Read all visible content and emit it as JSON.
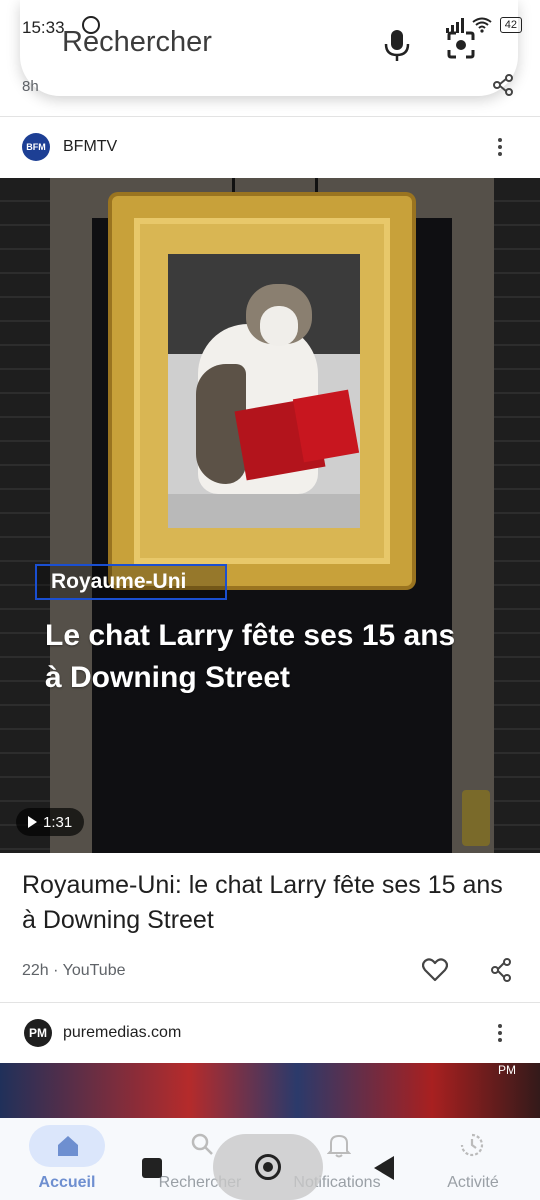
{
  "status_bar": {
    "time": "15:33",
    "battery": "42"
  },
  "search": {
    "placeholder": "Rechercher"
  },
  "previous_card": {
    "time": "8h"
  },
  "card_bfm": {
    "source": "BFMTV",
    "source_logo_text": "BFM",
    "overlay_tag": "Royaume-Uni",
    "overlay_headline": "Le chat Larry fête ses 15 ans à Downing Street",
    "duration": "1:31",
    "title": "Royaume-Uni: le chat Larry fête ses 15 ans à Downing Street",
    "meta": "22h · YouTube"
  },
  "card_pm": {
    "source": "puremedias.com",
    "source_logo_text": "PM",
    "badge": "PM"
  },
  "bottom_nav": {
    "items": [
      {
        "label": "Accueil",
        "icon": "home-icon",
        "active": true
      },
      {
        "label": "Rechercher",
        "icon": "search-icon"
      },
      {
        "label": "Notifications",
        "icon": "bell-icon"
      },
      {
        "label": "Activité",
        "icon": "history-icon"
      }
    ]
  },
  "colors": {
    "accent": "#6e8fd0",
    "bfm_blue": "#1d3f94",
    "tag_border": "#1a4fd1"
  }
}
